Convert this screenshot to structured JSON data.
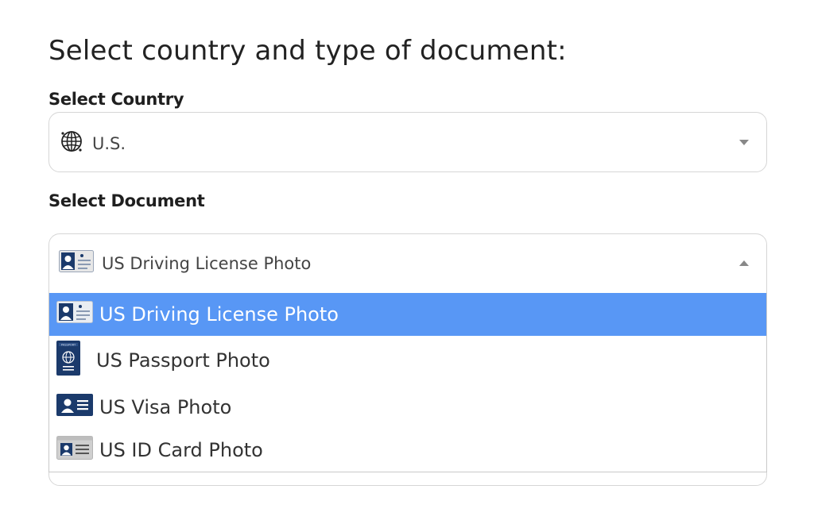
{
  "heading": "Select country and type of document:",
  "country": {
    "label": "Select Country",
    "value": "U.S.",
    "icon": "globe-icon"
  },
  "document": {
    "label": "Select Document",
    "value": "US Driving License Photo",
    "icon": "driving-license-icon",
    "options": [
      {
        "label": "US Driving License Photo",
        "icon": "driving-license-icon",
        "selected": true
      },
      {
        "label": "US Passport Photo",
        "icon": "passport-icon",
        "selected": false
      },
      {
        "label": "US Visa Photo",
        "icon": "visa-card-icon",
        "selected": false
      },
      {
        "label": "US ID Card Photo",
        "icon": "id-card-icon",
        "selected": false
      }
    ]
  },
  "colors": {
    "highlight": "#5897f5",
    "border": "#d6d6d6",
    "navy": "#1b3a6b"
  }
}
